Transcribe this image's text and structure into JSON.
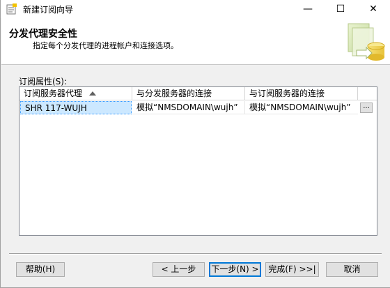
{
  "window": {
    "title": "新建订阅向导"
  },
  "caption_buttons": {
    "minimize": "—",
    "maximize": "☐",
    "close": "✕"
  },
  "header": {
    "title": "分发代理安全性",
    "subtitle": "指定每个分发代理的进程帐户和连接选项。"
  },
  "properties": {
    "label": "订阅属性(S):",
    "columns": [
      "订阅服务器代理",
      "与分发服务器的连接",
      "与订阅服务器的连接",
      ""
    ],
    "rows": [
      {
        "agent": "SHR 117-WUJH",
        "distributor_conn": "模拟“NMSDOMAIN\\wujh”",
        "subscriber_conn": "模拟“NMSDOMAIN\\wujh”",
        "button": "..."
      }
    ]
  },
  "buttons": {
    "help": "帮助(H)",
    "back": "< 上一步",
    "next": "下一步(N) >",
    "finish": "完成(F) >>|",
    "cancel": "取消"
  },
  "colors": {
    "selection": "#cce8ff",
    "focus": "#0078d7"
  }
}
